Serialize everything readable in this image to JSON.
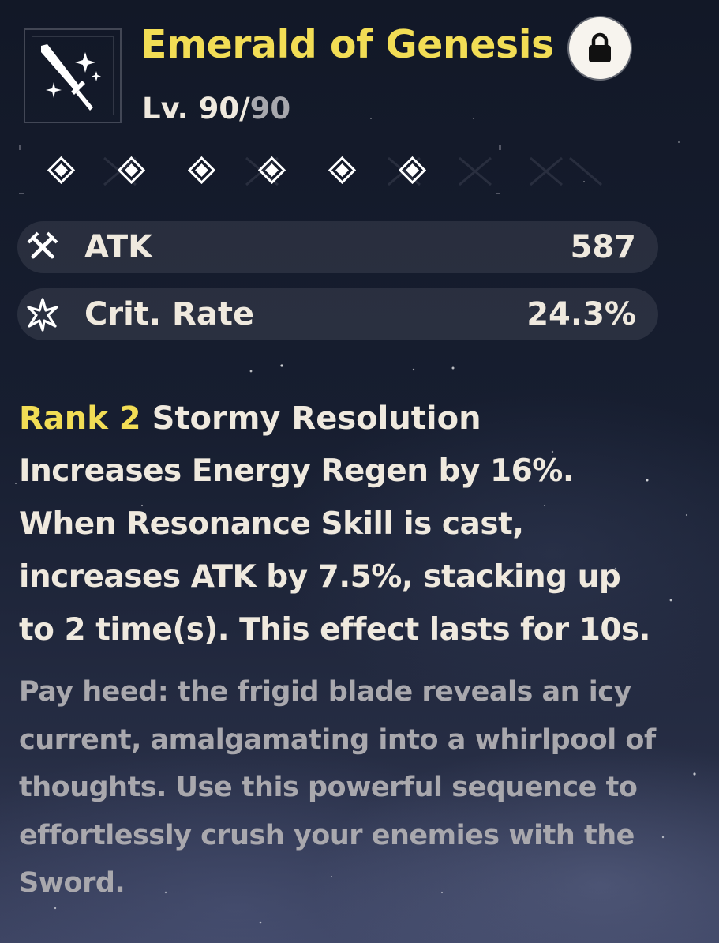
{
  "weapon": {
    "name": "Emerald of Genesis",
    "level_prefix": "Lv. ",
    "level_current": "90",
    "level_sep": "/",
    "level_max": "90",
    "icon": "sword-icon",
    "locked": true,
    "lock_icon": "lock-icon"
  },
  "rank": {
    "max": 6,
    "filled": 6
  },
  "stats": [
    {
      "icon": "atk-swords-icon",
      "label": "ATK",
      "value": "587"
    },
    {
      "icon": "crit-star-icon",
      "label": "Crit. Rate",
      "value": "24.3%"
    }
  ],
  "passive": {
    "rank_label": "Rank 2",
    "name": "Stormy Resolution",
    "lines": [
      "Increases Energy Regen by 16%.",
      "When Resonance Skill is cast,",
      "increases ATK by 7.5%, stacking up",
      "to 2 time(s). This effect lasts for 10s."
    ]
  },
  "flavor": {
    "lines": [
      "Pay heed: the frigid blade reveals an icy",
      "current, amalgamating into a whirlpool of",
      "thoughts. Use this powerful sequence to",
      "effortlessly crush your enemies with the",
      "Sword."
    ]
  },
  "colors": {
    "title": "#f2dd55",
    "text": "#efe9de",
    "muted": "#a9a8ad",
    "background": "#171e30"
  }
}
